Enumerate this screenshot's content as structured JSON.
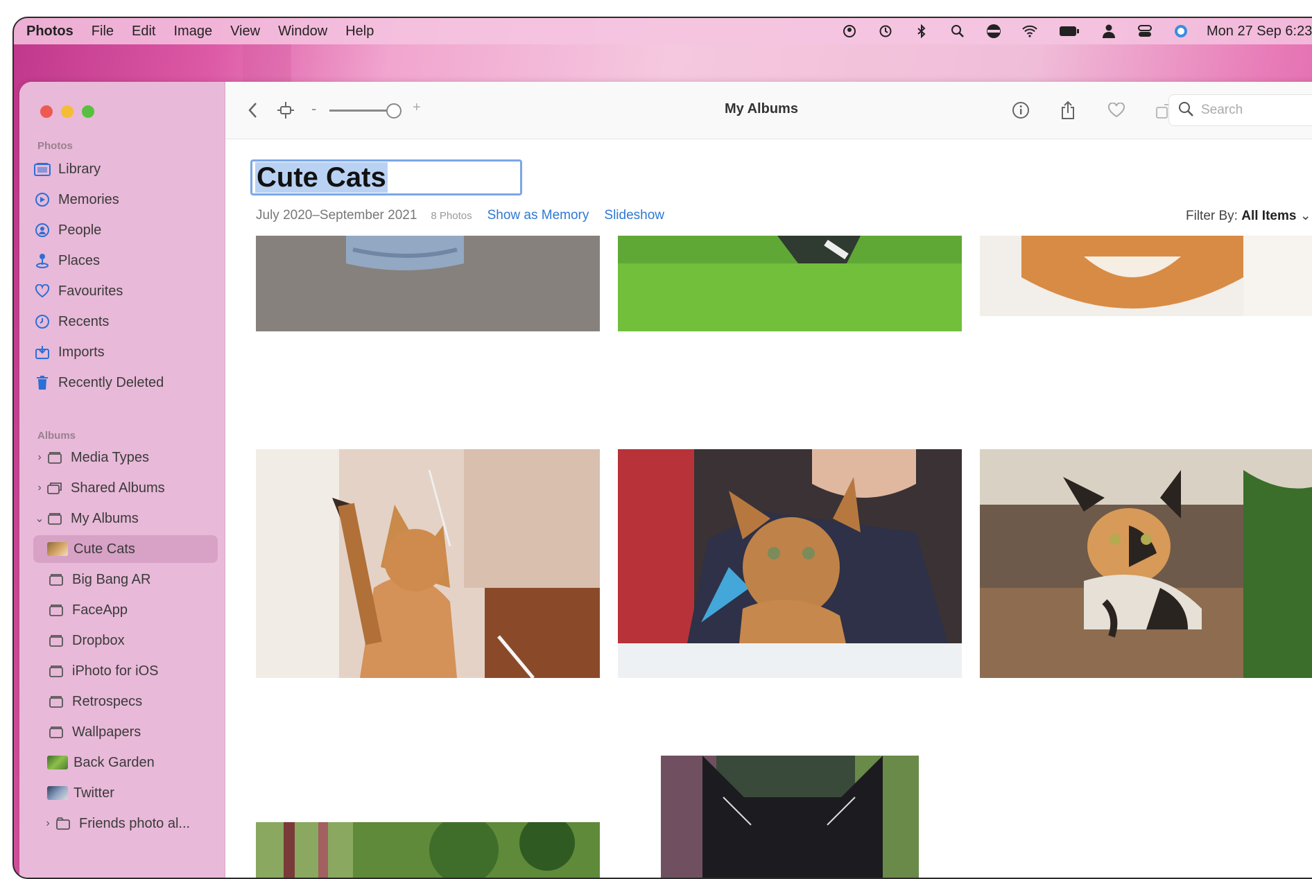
{
  "menubar": {
    "app": "Photos",
    "items": [
      "File",
      "Edit",
      "Image",
      "View",
      "Window",
      "Help"
    ],
    "clock": "Mon 27 Sep 6:23"
  },
  "sidebar": {
    "photos_header": "Photos",
    "photos_items": [
      {
        "label": "Library",
        "icon": "library-icon"
      },
      {
        "label": "Memories",
        "icon": "memories-icon"
      },
      {
        "label": "People",
        "icon": "people-icon"
      },
      {
        "label": "Places",
        "icon": "places-icon"
      },
      {
        "label": "Favourites",
        "icon": "heart-icon"
      },
      {
        "label": "Recents",
        "icon": "clock-icon"
      },
      {
        "label": "Imports",
        "icon": "import-icon"
      },
      {
        "label": "Recently Deleted",
        "icon": "trash-icon"
      }
    ],
    "albums_header": "Albums",
    "album_groups": [
      "Media Types",
      "Shared Albums",
      "My Albums"
    ],
    "my_albums": [
      "Cute Cats",
      "Big Bang AR",
      "FaceApp",
      "Dropbox",
      "iPhoto for iOS",
      "Retrospecs",
      "Wallpapers",
      "Back Garden",
      "Twitter",
      "Friends photo al..."
    ],
    "selected": "Cute Cats"
  },
  "toolbar": {
    "title": "My Albums",
    "search_placeholder": "Search"
  },
  "album": {
    "title": "Cute Cats",
    "date_range": "July 2020–September 2021",
    "count": "8 Photos",
    "show_as_memory": "Show as Memory",
    "slideshow": "Slideshow",
    "filter_label": "Filter By:",
    "filter_value": "All Items"
  }
}
